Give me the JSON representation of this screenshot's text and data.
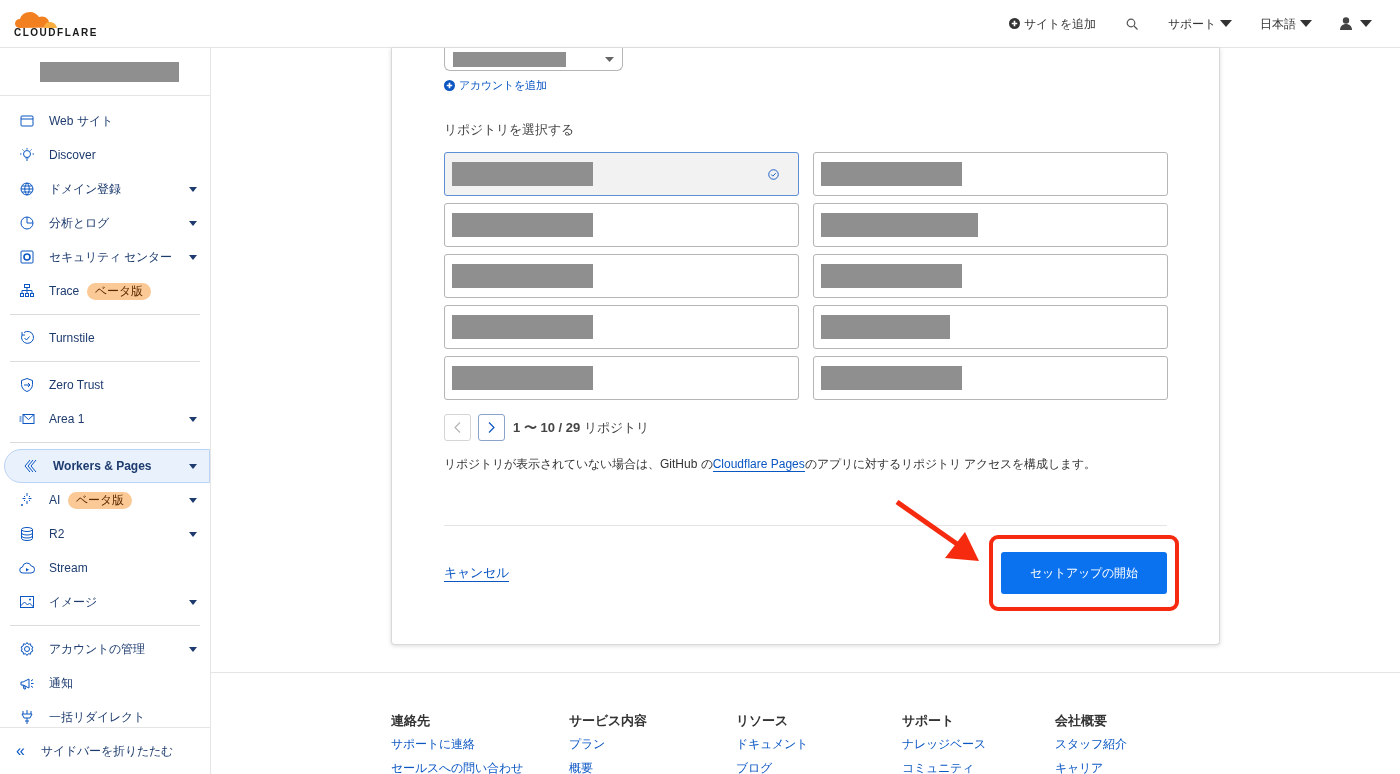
{
  "header": {
    "logo": "CLOUDFLARE",
    "actions": [
      {
        "kind": "add",
        "label": "サイトを追加"
      },
      {
        "kind": "search"
      },
      {
        "kind": "menu",
        "label": "サポート"
      },
      {
        "kind": "menu",
        "label": "日本語"
      },
      {
        "kind": "user"
      }
    ]
  },
  "sidebar": {
    "account_redacted": true,
    "groups": [
      [
        {
          "label": "Web サイト",
          "has_menu": false,
          "selected": false
        },
        {
          "label": "Discover",
          "has_menu": false,
          "selected": false
        },
        {
          "label": "ドメイン登録",
          "has_menu": true,
          "selected": false
        },
        {
          "label": "分析とログ",
          "has_menu": true,
          "selected": false
        },
        {
          "label": "セキュリティ センター",
          "has_menu": true,
          "selected": false
        },
        {
          "label": "Trace",
          "badge": "ベータ版",
          "has_menu": false,
          "selected": false
        }
      ],
      [
        {
          "label": "Turnstile",
          "has_menu": false,
          "selected": false
        }
      ],
      [
        {
          "label": "Zero Trust",
          "has_menu": false,
          "selected": false
        },
        {
          "label": "Area 1",
          "has_menu": true,
          "selected": false
        }
      ],
      [
        {
          "label": "Workers & Pages",
          "has_menu": true,
          "selected": true
        },
        {
          "label": "AI",
          "badge": "ベータ版",
          "has_menu": true,
          "selected": false
        },
        {
          "label": "R2",
          "has_menu": true,
          "selected": false
        },
        {
          "label": "Stream",
          "has_menu": false,
          "selected": false
        },
        {
          "label": "イメージ",
          "has_menu": true,
          "selected": false
        }
      ],
      [
        {
          "label": "アカウントの管理",
          "has_menu": true,
          "selected": false
        },
        {
          "label": "通知",
          "has_menu": false,
          "selected": false
        },
        {
          "label": "一括リダイレクト",
          "has_menu": false,
          "selected": false
        }
      ]
    ],
    "collapse": {
      "icon": "«",
      "label": "サイドバーを折りたたむ"
    }
  },
  "card": {
    "account_select_redacted": true,
    "add_account": "アカウントを追加",
    "repo_label": "リポジトリを選択する",
    "repos": [
      {
        "selected": true
      },
      {
        "selected": false
      },
      {
        "selected": false
      },
      {
        "selected": false
      },
      {
        "selected": false
      },
      {
        "selected": false
      },
      {
        "selected": false
      },
      {
        "selected": false
      },
      {
        "selected": false
      },
      {
        "selected": false
      }
    ],
    "pagination": {
      "prev_disabled": true,
      "next_disabled": false,
      "text": "**1 〜 10 / 29** リポジトリ"
    },
    "help": {
      "before": "リポジトリが表示されていない場合は、GitHub の",
      "link": "Cloudflare Pages",
      "after": "のアプリに対するリポジトリ アクセスを構成します。"
    },
    "cancel": "キャンセル",
    "submit": "セットアップの開始",
    "annotation": {
      "highlight": true,
      "arrow": true
    }
  },
  "footer": {
    "columns": [
      {
        "title": "連絡先",
        "links": [
          "サポートに連絡",
          "セールスへの問い合わせ"
        ]
      },
      {
        "title": "サービス内容",
        "links": [
          "プラン",
          "概要"
        ]
      },
      {
        "title": "リソース",
        "links": [
          "ドキュメント",
          "ブログ"
        ]
      },
      {
        "title": "サポート",
        "links": [
          "ナレッジベース",
          "コミュニティ"
        ]
      },
      {
        "title": "会社概要",
        "links": [
          "スタッフ紹介",
          "キャリア"
        ]
      }
    ]
  }
}
